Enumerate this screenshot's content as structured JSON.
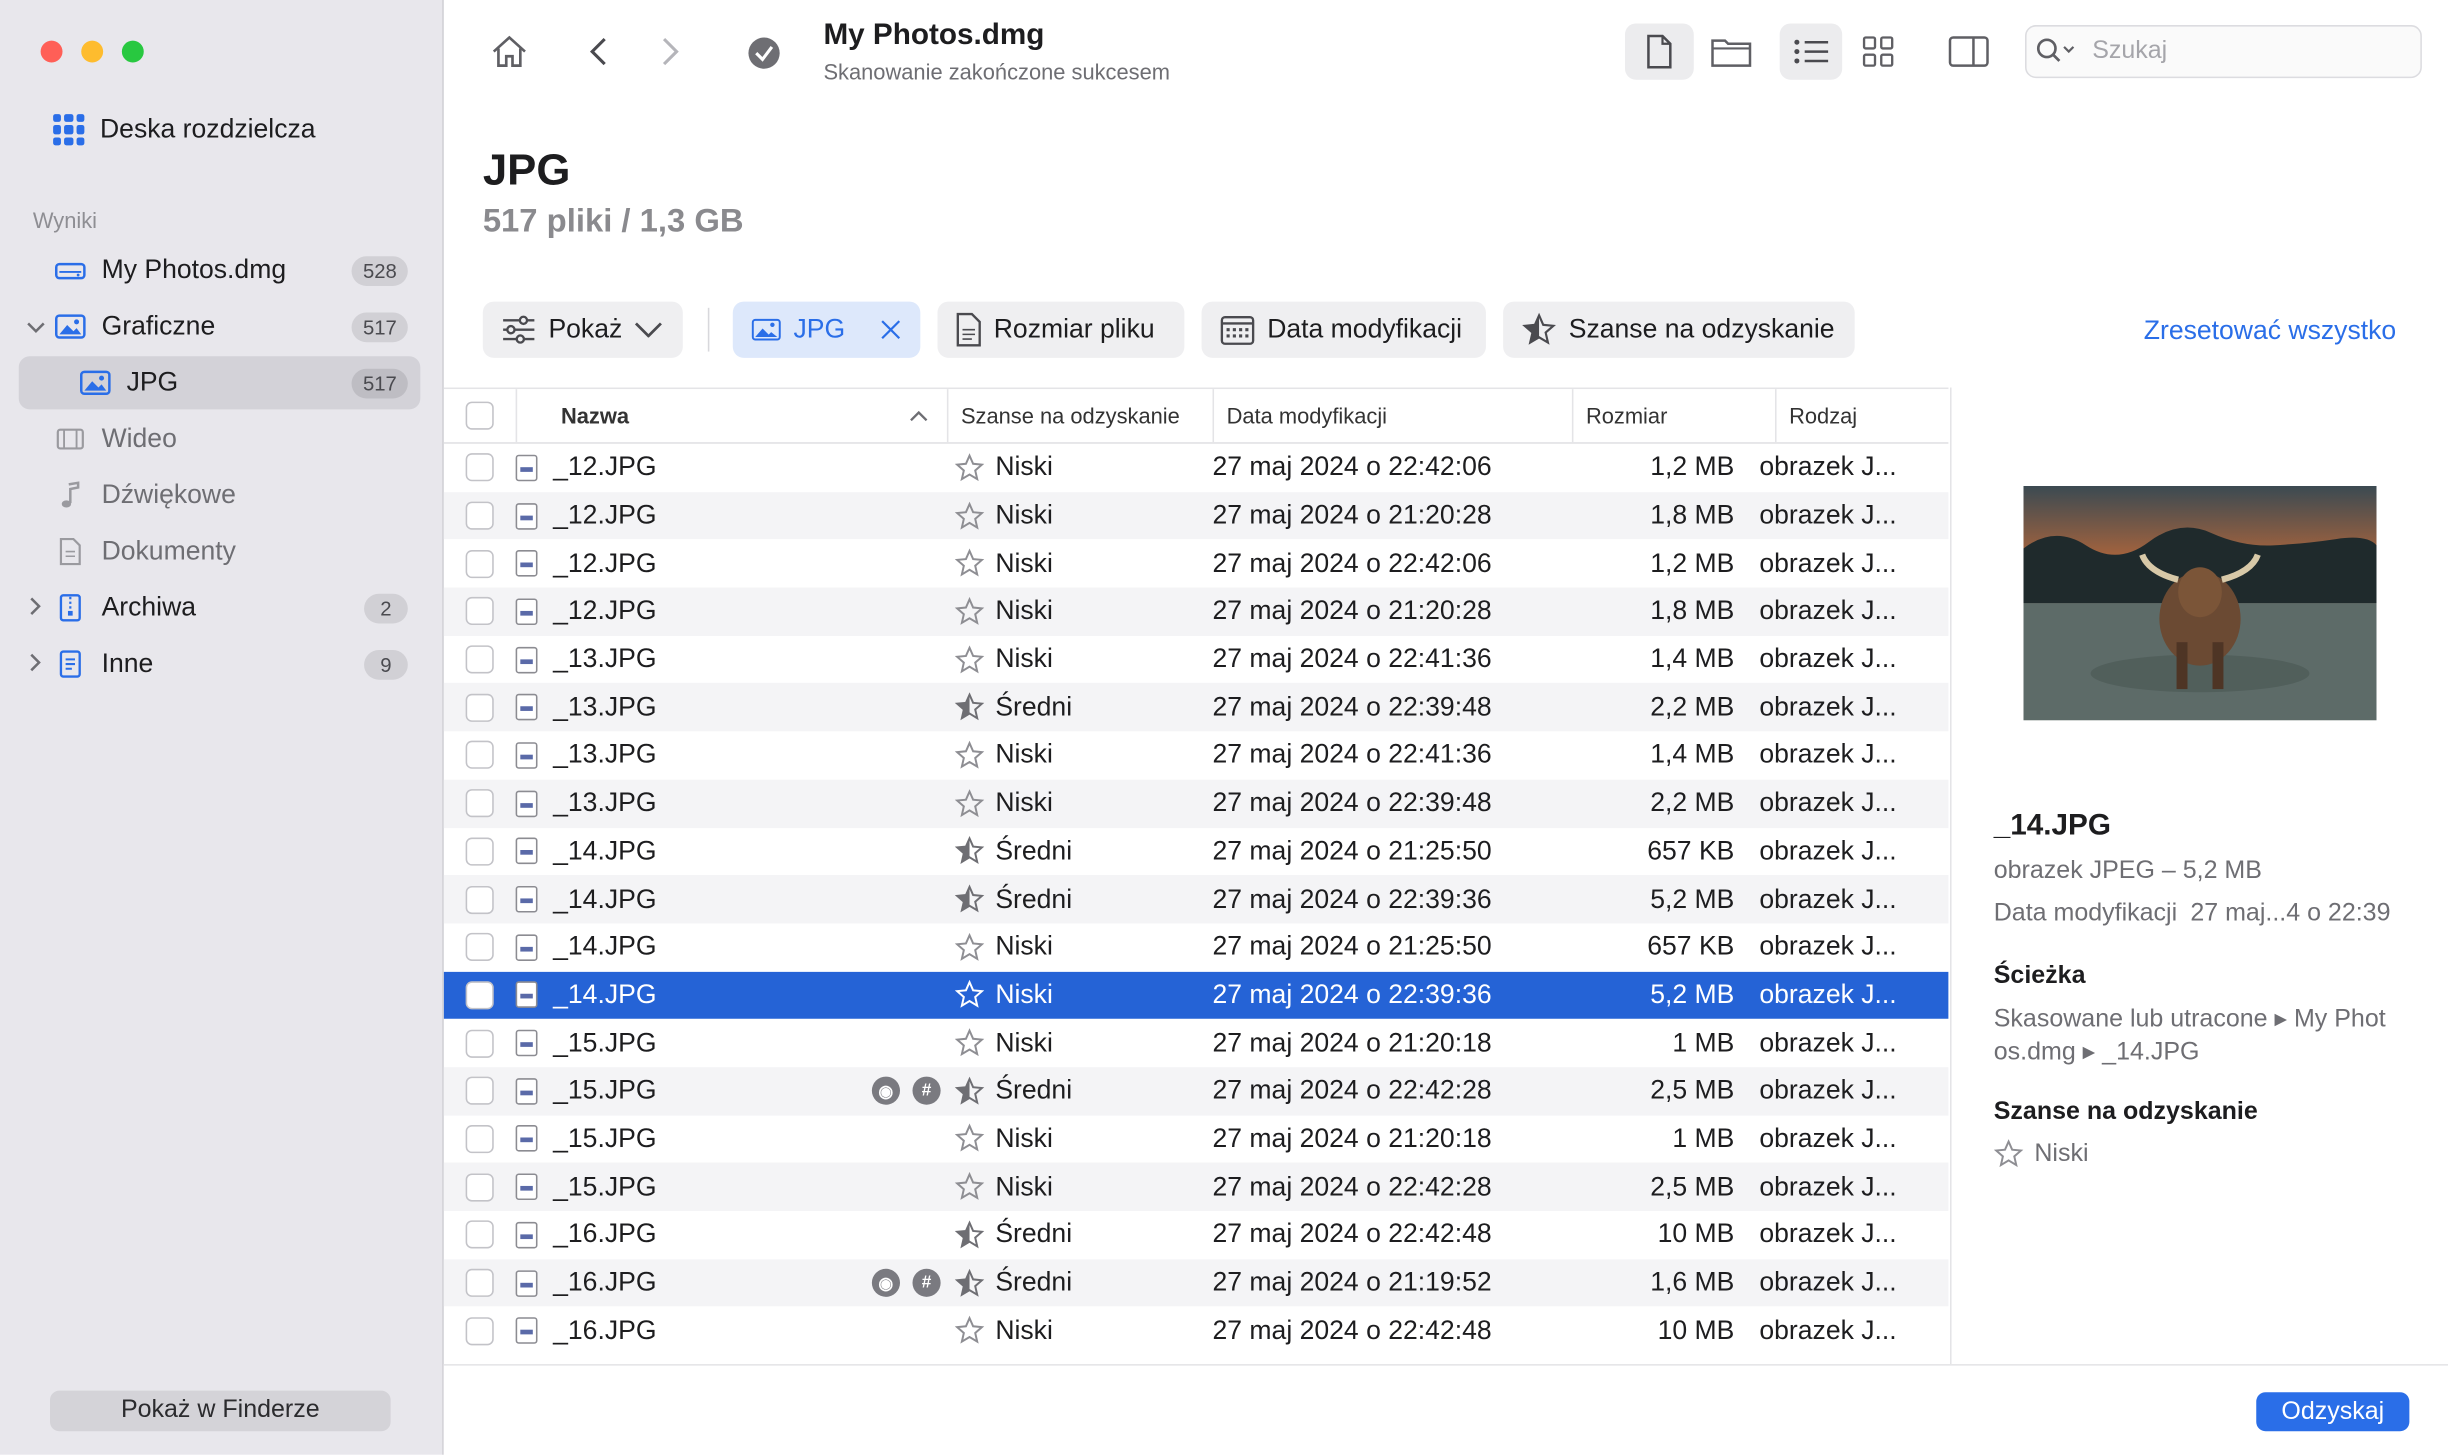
{
  "sidebar": {
    "dashboard_label": "Deska rozdzielcza",
    "section_label": "Wyniki",
    "items": [
      {
        "label": "My Photos.dmg",
        "badge": "528"
      },
      {
        "label": "Graficzne",
        "badge": "517"
      },
      {
        "label": "JPG",
        "badge": "517"
      },
      {
        "label": "Wideo"
      },
      {
        "label": "Dźwiękowe"
      },
      {
        "label": "Dokumenty"
      },
      {
        "label": "Archiwa",
        "badge": "2"
      },
      {
        "label": "Inne",
        "badge": "9"
      }
    ],
    "finder_button": "Pokaż w Finderze"
  },
  "toolbar": {
    "title": "My Photos.dmg",
    "subtitle": "Skanowanie zakończone sukcesem",
    "search_placeholder": "Szukaj"
  },
  "main": {
    "heading": "JPG",
    "subheading": "517 pliki / 1,3 GB"
  },
  "filters": {
    "show": "Pokaż",
    "jpg": "JPG",
    "file_size": "Rozmiar pliku",
    "mod_date": "Data modyfikacji",
    "chance": "Szanse na odzyskanie",
    "reset": "Zresetować wszystko"
  },
  "table": {
    "headers": {
      "name": "Nazwa",
      "chance": "Szanse na odzyskanie",
      "date": "Data modyfikacji",
      "size": "Rozmiar",
      "kind": "Rodzaj"
    },
    "rows": [
      {
        "name": "_12.JPG",
        "chance": "Niski",
        "date": "27 maj 2024 o 22:42:06",
        "size": "1,2 MB",
        "kind": "obrazek J..."
      },
      {
        "name": "_12.JPG",
        "chance": "Niski",
        "date": "27 maj 2024 o 21:20:28",
        "size": "1,8 MB",
        "kind": "obrazek J..."
      },
      {
        "name": "_12.JPG",
        "chance": "Niski",
        "date": "27 maj 2024 o 22:42:06",
        "size": "1,2 MB",
        "kind": "obrazek J..."
      },
      {
        "name": "_12.JPG",
        "chance": "Niski",
        "date": "27 maj 2024 o 21:20:28",
        "size": "1,8 MB",
        "kind": "obrazek J..."
      },
      {
        "name": "_13.JPG",
        "chance": "Niski",
        "date": "27 maj 2024 o 22:41:36",
        "size": "1,4 MB",
        "kind": "obrazek J..."
      },
      {
        "name": "_13.JPG",
        "chance": "Średni",
        "date": "27 maj 2024 o 22:39:48",
        "size": "2,2 MB",
        "kind": "obrazek J..."
      },
      {
        "name": "_13.JPG",
        "chance": "Niski",
        "date": "27 maj 2024 o 22:41:36",
        "size": "1,4 MB",
        "kind": "obrazek J..."
      },
      {
        "name": "_13.JPG",
        "chance": "Niski",
        "date": "27 maj 2024 o 22:39:48",
        "size": "2,2 MB",
        "kind": "obrazek J..."
      },
      {
        "name": "_14.JPG",
        "chance": "Średni",
        "date": "27 maj 2024 o 21:25:50",
        "size": "657 KB",
        "kind": "obrazek J..."
      },
      {
        "name": "_14.JPG",
        "chance": "Średni",
        "date": "27 maj 2024 o 22:39:36",
        "size": "5,2 MB",
        "kind": "obrazek J..."
      },
      {
        "name": "_14.JPG",
        "chance": "Niski",
        "date": "27 maj 2024 o 21:25:50",
        "size": "657 KB",
        "kind": "obrazek J..."
      },
      {
        "name": "_14.JPG",
        "chance": "Niski",
        "date": "27 maj 2024 o 22:39:36",
        "size": "5,2 MB",
        "kind": "obrazek J...",
        "selected": true
      },
      {
        "name": "_15.JPG",
        "chance": "Niski",
        "date": "27 maj 2024 o 21:20:18",
        "size": "1 MB",
        "kind": "obrazek J..."
      },
      {
        "name": "_15.JPG",
        "chance": "Średni",
        "date": "27 maj 2024 o 22:42:28",
        "size": "2,5 MB",
        "kind": "obrazek J...",
        "tags": true
      },
      {
        "name": "_15.JPG",
        "chance": "Niski",
        "date": "27 maj 2024 o 21:20:18",
        "size": "1 MB",
        "kind": "obrazek J..."
      },
      {
        "name": "_15.JPG",
        "chance": "Niski",
        "date": "27 maj 2024 o 22:42:28",
        "size": "2,5 MB",
        "kind": "obrazek J..."
      },
      {
        "name": "_16.JPG",
        "chance": "Średni",
        "date": "27 maj 2024 o 22:42:48",
        "size": "10 MB",
        "kind": "obrazek J..."
      },
      {
        "name": "_16.JPG",
        "chance": "Średni",
        "date": "27 maj 2024 o 21:19:52",
        "size": "1,6 MB",
        "kind": "obrazek J...",
        "tags": true
      },
      {
        "name": "_16.JPG",
        "chance": "Niski",
        "date": "27 maj 2024 o 22:42:48",
        "size": "10 MB",
        "kind": "obrazek J..."
      }
    ]
  },
  "preview": {
    "name": "_14.JPG",
    "kind": "obrazek JPEG – 5,2 MB",
    "mod_label": "Data modyfikacji",
    "mod_value": "27 maj...4 o 22:39",
    "path_heading": "Ścieżka",
    "path_line1": "Skasowane lub utracone ▸ My Phot",
    "path_line2": "os.dmg ▸ _14.JPG",
    "chance_heading": "Szanse na odzyskanie",
    "chance_value": "Niski"
  },
  "footer": {
    "recover_button": "Odzyskaj"
  },
  "colors": {
    "accent": "#2a6ee8",
    "selection": "#2563d6",
    "sidebar_bg": "#e8e7ec"
  }
}
